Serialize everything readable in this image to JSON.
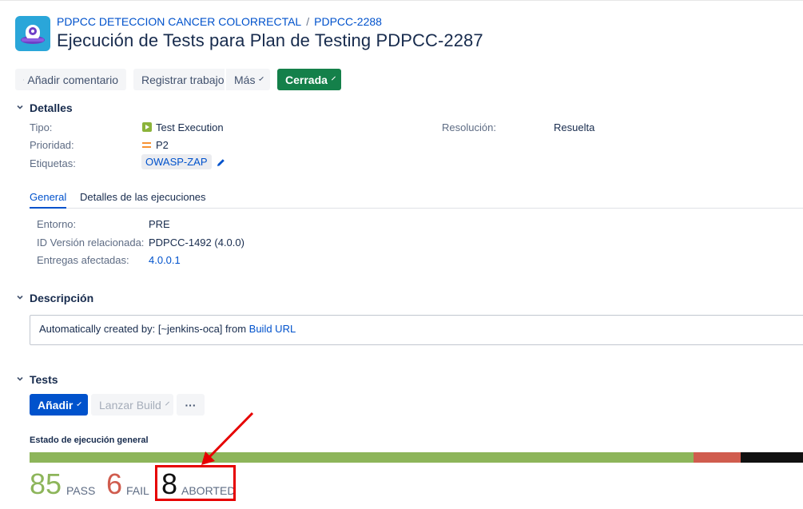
{
  "header": {
    "breadcrumb": [
      "PDPCC DETECCION CANCER COLORRECTAL",
      "PDPCC-2288"
    ],
    "breadcrumb_sep": "/",
    "title": "Ejecución de Tests para Plan de Testing PDPCC-2287"
  },
  "toolbar": {
    "comment_label": "Añadir comentario",
    "log_label": "Registrar trabajo",
    "more_label": "Más",
    "status_label": "Cerrada"
  },
  "details": {
    "title": "Detalles",
    "type_label": "Tipo:",
    "type_value": "Test Execution",
    "priority_label": "Prioridad:",
    "priority_value": "P2",
    "labels_label": "Etiquetas:",
    "labels_value": "OWASP-ZAP",
    "resolution_label": "Resolución:",
    "resolution_value": "Resuelta"
  },
  "tabs": [
    "General",
    "Detalles de las ejecuciones"
  ],
  "general": {
    "env_label": "Entorno:",
    "env_value": "PRE",
    "version_label": "ID Versión relacionada:",
    "version_value": "PDPCC-1492 (4.0.0)",
    "deliveries_label": "Entregas afectadas:",
    "deliveries_value": "4.0.0.1"
  },
  "description": {
    "title": "Descripción",
    "text": "Automatically created by: [~jenkins-oca] from",
    "link": "Build URL"
  },
  "tests": {
    "title": "Tests",
    "add_label": "Añadir",
    "build_label": "Lanzar Build",
    "dots_label": "···",
    "exec_label": "Estado de ejecución general",
    "stats": [
      {
        "count": "85",
        "label": "PASS",
        "color": "#8db55a"
      },
      {
        "count": "6",
        "label": "FAIL",
        "color": "#d05c4e"
      },
      {
        "count": "8",
        "label": "ABORTED",
        "color": "#111111"
      }
    ]
  },
  "colors": {
    "pass": "#8db55a",
    "fail": "#d05c4e",
    "aborted": "#111111",
    "annotation": "#e60000"
  }
}
